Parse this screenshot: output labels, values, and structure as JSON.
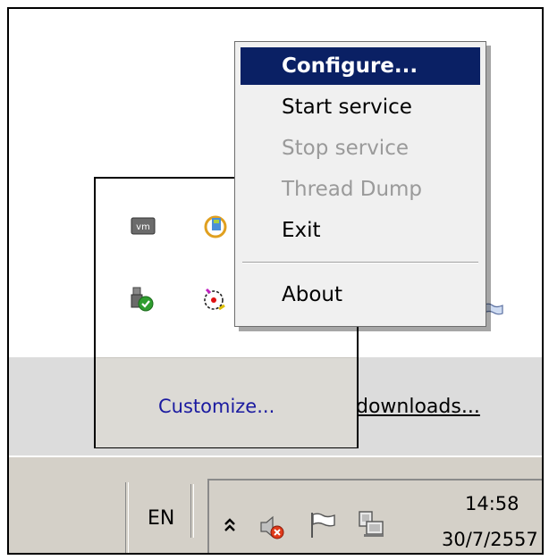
{
  "context_menu": {
    "items": [
      {
        "label": "Configure...",
        "state": "highlighted"
      },
      {
        "label": "Start service",
        "state": "enabled"
      },
      {
        "label": "Stop service",
        "state": "disabled"
      },
      {
        "label": "Thread Dump",
        "state": "disabled"
      },
      {
        "label": "Exit",
        "state": "enabled"
      },
      {
        "label": "About",
        "state": "enabled"
      }
    ]
  },
  "overflow_panel": {
    "customize_label": "Customize...",
    "icons": [
      "vmware-tools-icon",
      "windows-update-icon",
      "usb-safe-remove-icon",
      "service-app-icon"
    ]
  },
  "desktop": {
    "downloads_link": "downloads..."
  },
  "taskbar": {
    "language": "EN",
    "clock_time": "14:58",
    "clock_date": "30/7/2557",
    "tray_icons": [
      "volume-muted-icon",
      "action-center-flag-icon",
      "network-icon"
    ]
  },
  "colors": {
    "menu_highlight": "#0a2064",
    "disabled_text": "#9a9a9a",
    "link_blue": "#1a1aa0",
    "taskbar": "#d4d0c8"
  }
}
